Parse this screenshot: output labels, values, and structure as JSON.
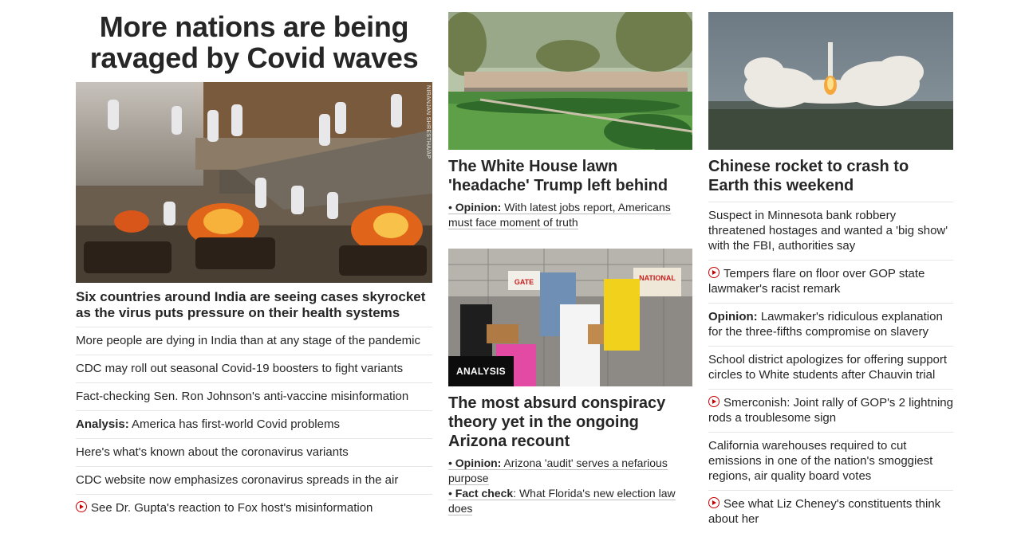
{
  "left": {
    "title": "More nations are being ravaged by Covid waves",
    "image_credit": "NIRANJAN SHRESTHA/AP",
    "lead_headline": "Six countries around India are seeing cases skyrocket as the virus puts pressure on their health systems",
    "items": [
      {
        "prefix": "",
        "text": "More people are dying in India than at any stage of the pandemic",
        "video": false
      },
      {
        "prefix": "",
        "text": "CDC may roll out seasonal Covid-19 boosters to fight variants",
        "video": false
      },
      {
        "prefix": "",
        "text": "Fact-checking Sen. Ron Johnson's anti-vaccine misinformation",
        "video": false
      },
      {
        "prefix": "Analysis:",
        "text": " America has first-world Covid problems",
        "video": false
      },
      {
        "prefix": "",
        "text": "Here's what's known about the coronavirus variants",
        "video": false
      },
      {
        "prefix": "",
        "text": "CDC website now emphasizes coronavirus spreads in the air",
        "video": false
      },
      {
        "prefix": "",
        "text": "See Dr. Gupta's reaction to Fox host's misinformation",
        "video": true
      }
    ]
  },
  "middle": {
    "card1": {
      "headline": "The White House lawn 'headache' Trump left behind",
      "sub_prefix": "Opinion:",
      "sub_text": "With latest jobs report, Americans must face moment of truth"
    },
    "card2": {
      "badge": "ANALYSIS",
      "headline": "The most absurd conspiracy theory yet in the ongoing Arizona recount",
      "sub1_prefix": "Opinion:",
      "sub1_text": "Arizona 'audit' serves a nefarious purpose",
      "sub2_prefix": "Fact check",
      "sub2_text": ": What Florida's new election law does",
      "sign_gate": "GATE",
      "sign_national": "NATIONAL"
    }
  },
  "right": {
    "headline": "Chinese rocket to crash to Earth this weekend",
    "items": [
      {
        "prefix": "",
        "text": "Suspect in Minnesota bank robbery threatened hostages and wanted a 'big show' with the FBI, authorities say",
        "video": false
      },
      {
        "prefix": "",
        "text": "Tempers flare on floor over GOP state lawmaker's racist remark",
        "video": true
      },
      {
        "prefix": "Opinion:",
        "text": " Lawmaker's ridiculous explanation for the three-fifths compromise on slavery",
        "video": false
      },
      {
        "prefix": "",
        "text": "School district apologizes for offering support circles to White students after Chauvin trial",
        "video": false
      },
      {
        "prefix": "",
        "text": "Smerconish: Joint rally of GOP's 2 lightning rods a troublesome sign",
        "video": true
      },
      {
        "prefix": "",
        "text": "California warehouses required to cut emissions in one of the nation's smoggiest regions, air quality board votes",
        "video": false
      },
      {
        "prefix": "",
        "text": "See what Liz Cheney's constituents think about her",
        "video": true
      }
    ]
  },
  "colors": {
    "text": "#262626",
    "video_red": "#cc0000",
    "divider": "#e6e6e6",
    "badge_bg": "#0c0c0c"
  }
}
